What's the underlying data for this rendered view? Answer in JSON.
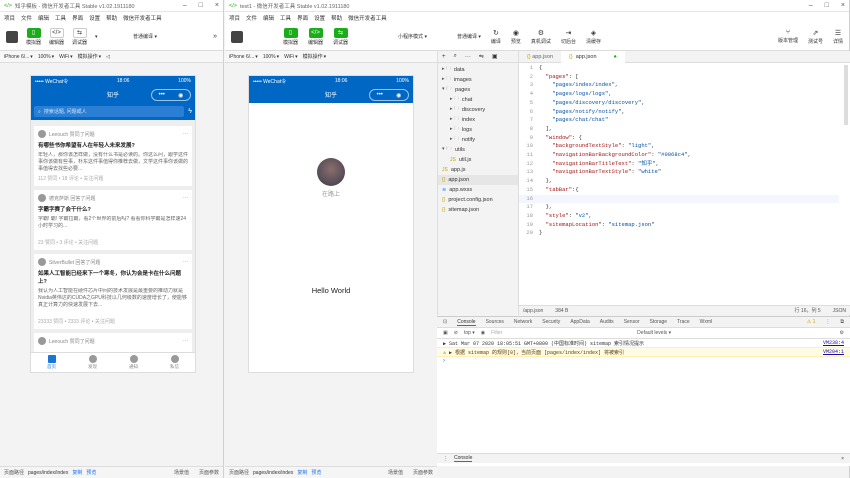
{
  "win1": {
    "title": "知乎模板 - 微信开发者工具 Stable v1.02.1911180",
    "menu": [
      "项目",
      "文件",
      "编辑",
      "工具",
      "界面",
      "设置",
      "帮助",
      "微信开发者工具"
    ],
    "toolbar": {
      "simulator": "模拟器",
      "editor": "编辑器",
      "debugger": "调试器",
      "compile_mode": "普通编译"
    },
    "device": "iPhone 6/...",
    "zoom": "100%",
    "net": "WiFi",
    "op": "模拟操作",
    "phone": {
      "carrier": "••••• WeChat令",
      "time": "18:06",
      "battery": "100%",
      "nav_title": "知乎",
      "search_placeholder": "搜索话题, 问题或人",
      "cards": [
        {
          "author": "Leeouch 赞同了问题",
          "question": "有哪些书你希望有人在年轻人未来发展?",
          "answer": "年轻人，那你该怎样做，没有什么书是必读的。你这么问，跟学这件事你该做有些事，朴东这件事值得你推荐去做，文学这件事你该做的事值得去找些必要...",
          "stats": "112 赞同 • 18 评论 • 关注问题"
        },
        {
          "author": "德克萨斯 回答了问题",
          "question": "字霸字赛了会干什么?",
          "answer": "字霸! 霸!\n字霸拉霸，看2个世界的前后吗? 看看你科学霸是怎样速24小时学习的...",
          "stats": "23 赞同 • 3 评论 • 关注问题"
        },
        {
          "author": "SilverBullet 回答了问题",
          "question": "如果人工智能已经来下一个寒冬，你认为会是卡在什么问题上?",
          "answer": "我认为人工智能在硬件芯片中间的技术发展是最重要的推动力就是Nvidia英伟达的CUDA之GPU科技以几何级数的速度增长了，使能够真正计算力的快速发展下去...",
          "stats": "23333 赞同 • 2333 评论 • 关注问题"
        },
        {
          "author": "Leeouch 赞同了问题",
          "question": "",
          "answer": "",
          "stats": ""
        }
      ],
      "tabs": [
        "首页",
        "发现",
        "通知",
        "私信"
      ]
    },
    "status": {
      "path_label": "页面路径",
      "path": "pages/index/index",
      "copy": "复制",
      "preview": "预览",
      "scene": "场景值",
      "params": "页面参数"
    }
  },
  "win2": {
    "title": "test1 - 微信开发者工具 Stable v1.02.1911180",
    "menu": [
      "项目",
      "文件",
      "编辑",
      "工具",
      "界面",
      "设置",
      "帮助",
      "微信开发者工具"
    ],
    "toolbar": {
      "simulator": "模拟器",
      "editor": "编辑器",
      "debugger": "调试器",
      "mode": "小程序模式",
      "compile_mode": "普通编译",
      "compile": "编译",
      "preview": "预览",
      "remote": "真机调试",
      "backend": "切后台",
      "cache": "清缓存",
      "version": "版本管理",
      "test": "测试号",
      "details": "详情"
    },
    "device": "iPhone 6/...",
    "zoom": "100%",
    "net": "WiFi",
    "op": "模拟操作",
    "phone": {
      "carrier": "••••• WeChat令",
      "time": "18:06",
      "battery": "100%",
      "nav_title": "知乎",
      "username": "在路上",
      "hello": "Hello World"
    },
    "files": [
      {
        "name": "data",
        "indent": 0,
        "type": "folder"
      },
      {
        "name": "images",
        "indent": 0,
        "type": "folder"
      },
      {
        "name": "pages",
        "indent": 0,
        "type": "folder-open"
      },
      {
        "name": "chat",
        "indent": 1,
        "type": "folder"
      },
      {
        "name": "discovery",
        "indent": 1,
        "type": "folder"
      },
      {
        "name": "index",
        "indent": 1,
        "type": "folder"
      },
      {
        "name": "logs",
        "indent": 1,
        "type": "folder"
      },
      {
        "name": "notify",
        "indent": 1,
        "type": "folder"
      },
      {
        "name": "utils",
        "indent": 0,
        "type": "folder-open"
      },
      {
        "name": "util.js",
        "indent": 1,
        "type": "js"
      },
      {
        "name": "app.js",
        "indent": 0,
        "type": "js"
      },
      {
        "name": "app.json",
        "indent": 0,
        "type": "json"
      },
      {
        "name": "app.wxss",
        "indent": 0,
        "type": "wxss"
      },
      {
        "name": "project.config.json",
        "indent": 0,
        "type": "json"
      },
      {
        "name": "sitemap.json",
        "indent": 0,
        "type": "json"
      }
    ],
    "editor_tabs": [
      "app.json",
      "app.json"
    ],
    "code": [
      "{",
      "  \"pages\": [",
      "    \"pages/index/index\",",
      "    \"pages/logs/logs\",",
      "    \"pages/discovery/discovery\",",
      "    \"pages/notify/notify\",",
      "    \"pages/chat/chat\"",
      "  ],",
      "  \"window\": {",
      "    \"backgroundTextStyle\": \"light\",",
      "    \"navigationBarBackgroundColor\": \"#0068c4\",",
      "    \"navigationBarTitleText\": \"知乎\",",
      "    \"navigationBarTextStyle\": \"white\"",
      "  },",
      "  \"tabBar\":{",
      "    ",
      "  },",
      "  \"style\": \"v2\",",
      "  \"sitemapLocation\": \"sitemap.json\"",
      "}"
    ],
    "editor_status": {
      "file": "/app.json",
      "size": "384 B",
      "pos": "行 16，列 5",
      "lang": "JSON"
    },
    "devtools_tabs": [
      "Console",
      "Sources",
      "Network",
      "Security",
      "AppData",
      "Audits",
      "Sensor",
      "Storage",
      "Trace",
      "Wxml"
    ],
    "console_filter": {
      "context": "top",
      "placeholder": "Filter",
      "levels": "Default levels ▾"
    },
    "console_lines": [
      {
        "text": "▶ Sat Mar 07 2020 18:05:51 GMT+0800 (中国标准时间) sitemap 索引情况提示",
        "src": "VM238:4"
      },
      {
        "text": "⚠ ▶ 根据 sitemap 的规则[0]，当前页面 [pages/index/index] 将被索引",
        "src": "VM204:1"
      }
    ],
    "bottom_console": "Console",
    "status": {
      "path_label": "页面路径",
      "path": "pages/index/index",
      "copy": "复制",
      "preview": "预览",
      "scene": "场景值",
      "params": "页面参数"
    }
  },
  "colors": {
    "brand_blue": "#0068c4",
    "wechat_green": "#1aad19"
  }
}
